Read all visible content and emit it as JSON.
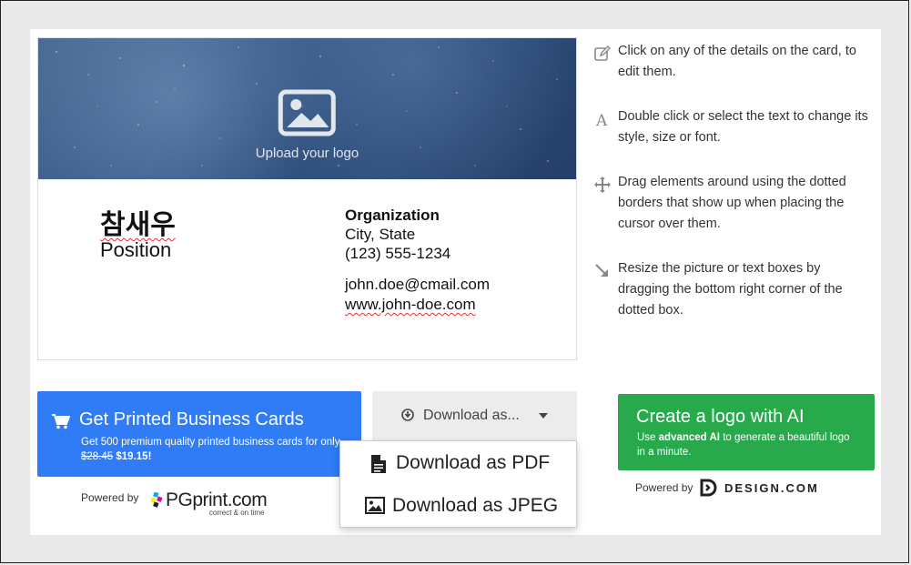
{
  "card": {
    "upload_logo_label": "Upload your logo",
    "name": "참새우",
    "position": "Position",
    "organization": "Organization",
    "city_state": "City, State",
    "phone": "(123) 555-1234",
    "email": "john.doe@cmail.com",
    "website": "www.john-doe.com"
  },
  "tips": [
    {
      "icon": "edit-icon",
      "text": "Click on any of the details on the card, to edit them."
    },
    {
      "icon": "font-icon",
      "text": "Double click or select the text to change its style, size or font."
    },
    {
      "icon": "move-icon",
      "text": "Drag elements around using the dotted borders that show up when placing the cursor over them."
    },
    {
      "icon": "resize-icon",
      "text": "Resize the picture or text boxes by dragging the bottom right corner of the dotted box."
    }
  ],
  "print_button": {
    "title": "Get Printed Business Cards",
    "sub_prefix": "Get 500 premium quality printed business cards for only",
    "old_price": "$28.45",
    "new_price": "$19.15",
    "sub_suffix": "!"
  },
  "powered_pg": {
    "label": "Powered by",
    "brand": "PGprint.com",
    "tagline": "correct & on time"
  },
  "download": {
    "label": "Download as...",
    "options": [
      "Download as PDF",
      "Download as JPEG"
    ]
  },
  "ai_button": {
    "title": "Create a logo with AI",
    "sub_prefix": "Use",
    "sub_bold": "advanced AI",
    "sub_suffix": "to generate a beautiful logo in a minute."
  },
  "powered_design": {
    "label": "Powered by",
    "brand": "DESIGN.COM"
  },
  "colors": {
    "print_blue": "#2f7cf6",
    "ai_green": "#27a94c",
    "download_gray": "#ececec"
  }
}
